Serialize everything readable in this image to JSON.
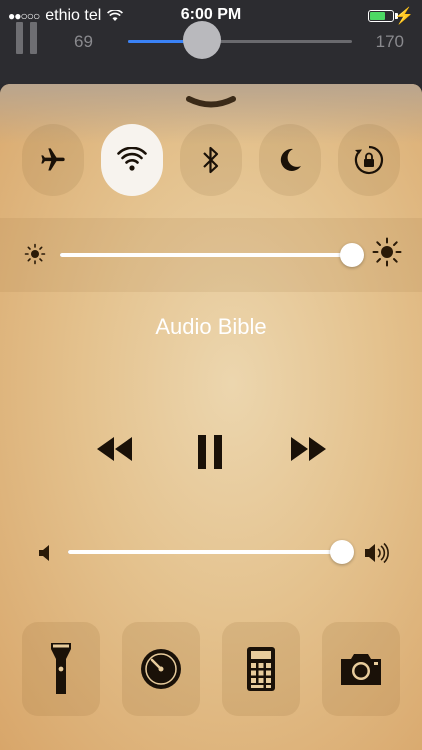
{
  "status": {
    "signal_dots": "●●○○○",
    "carrier": "ethio tel",
    "time": "6:00 PM",
    "battery_level": 0.7,
    "charging_icon": "bolt-icon"
  },
  "player_bar": {
    "seek_min_label": "69",
    "seek_max_label": "170",
    "seek_progress": 0.33
  },
  "control_center": {
    "toggles": [
      {
        "name": "airplane-mode",
        "icon": "airplane-icon",
        "on": false
      },
      {
        "name": "wifi",
        "icon": "wifi-icon",
        "on": true
      },
      {
        "name": "bluetooth",
        "icon": "bluetooth-icon",
        "on": false
      },
      {
        "name": "do-not-disturb",
        "icon": "moon-icon",
        "on": false
      },
      {
        "name": "rotation-lock",
        "icon": "rotation-lock-icon",
        "on": false
      }
    ],
    "brightness_level": 1.0,
    "now_playing": "Audio Bible",
    "volume_level": 1.0,
    "shortcuts": [
      {
        "name": "flashlight",
        "icon": "flashlight-icon"
      },
      {
        "name": "timer",
        "icon": "timer-icon"
      },
      {
        "name": "calculator",
        "icon": "calculator-icon"
      },
      {
        "name": "camera",
        "icon": "camera-icon"
      }
    ],
    "colors": {
      "panel": "#e4c28e",
      "icon": "#1a1108",
      "active_toggle": "#f7f3ee",
      "seek_fill": "#3a82f6"
    }
  }
}
